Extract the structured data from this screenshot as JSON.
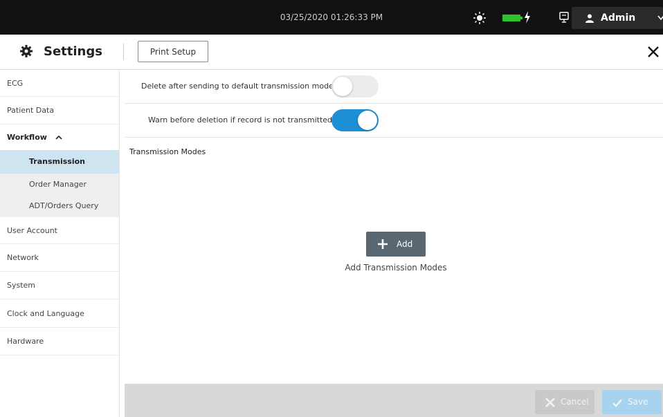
{
  "status_bar": {
    "datetime": "03/25/2020 01:26:33 PM",
    "user_label": "Admin",
    "battery_color": "#2fc22f"
  },
  "header": {
    "title": "Settings",
    "print_setup_label": "Print Setup"
  },
  "sidebar": {
    "items": [
      {
        "label": "ECG"
      },
      {
        "label": "Patient Data"
      },
      {
        "label": "Workflow"
      },
      {
        "label": "Transmission",
        "active": true
      },
      {
        "label": "Order Manager"
      },
      {
        "label": "ADT/Orders Query"
      },
      {
        "label": "User Account"
      },
      {
        "label": "Network"
      },
      {
        "label": "System"
      },
      {
        "label": "Clock and Language"
      },
      {
        "label": "Hardware"
      }
    ]
  },
  "settings": {
    "delete_after_sending": {
      "label": "Delete after sending to default transmission mode",
      "enabled": false
    },
    "warn_before_deletion": {
      "label": "Warn before deletion if record is not transmitted",
      "enabled": true
    }
  },
  "transmission": {
    "section_title": "Transmission Modes",
    "add_button_label": "Add",
    "add_caption": "Add Transmission Modes"
  },
  "footer": {
    "cancel_label": "Cancel",
    "save_label": "Save"
  },
  "colors": {
    "accent": "#1e8fd6",
    "selected_nav": "#cfe4f1"
  }
}
